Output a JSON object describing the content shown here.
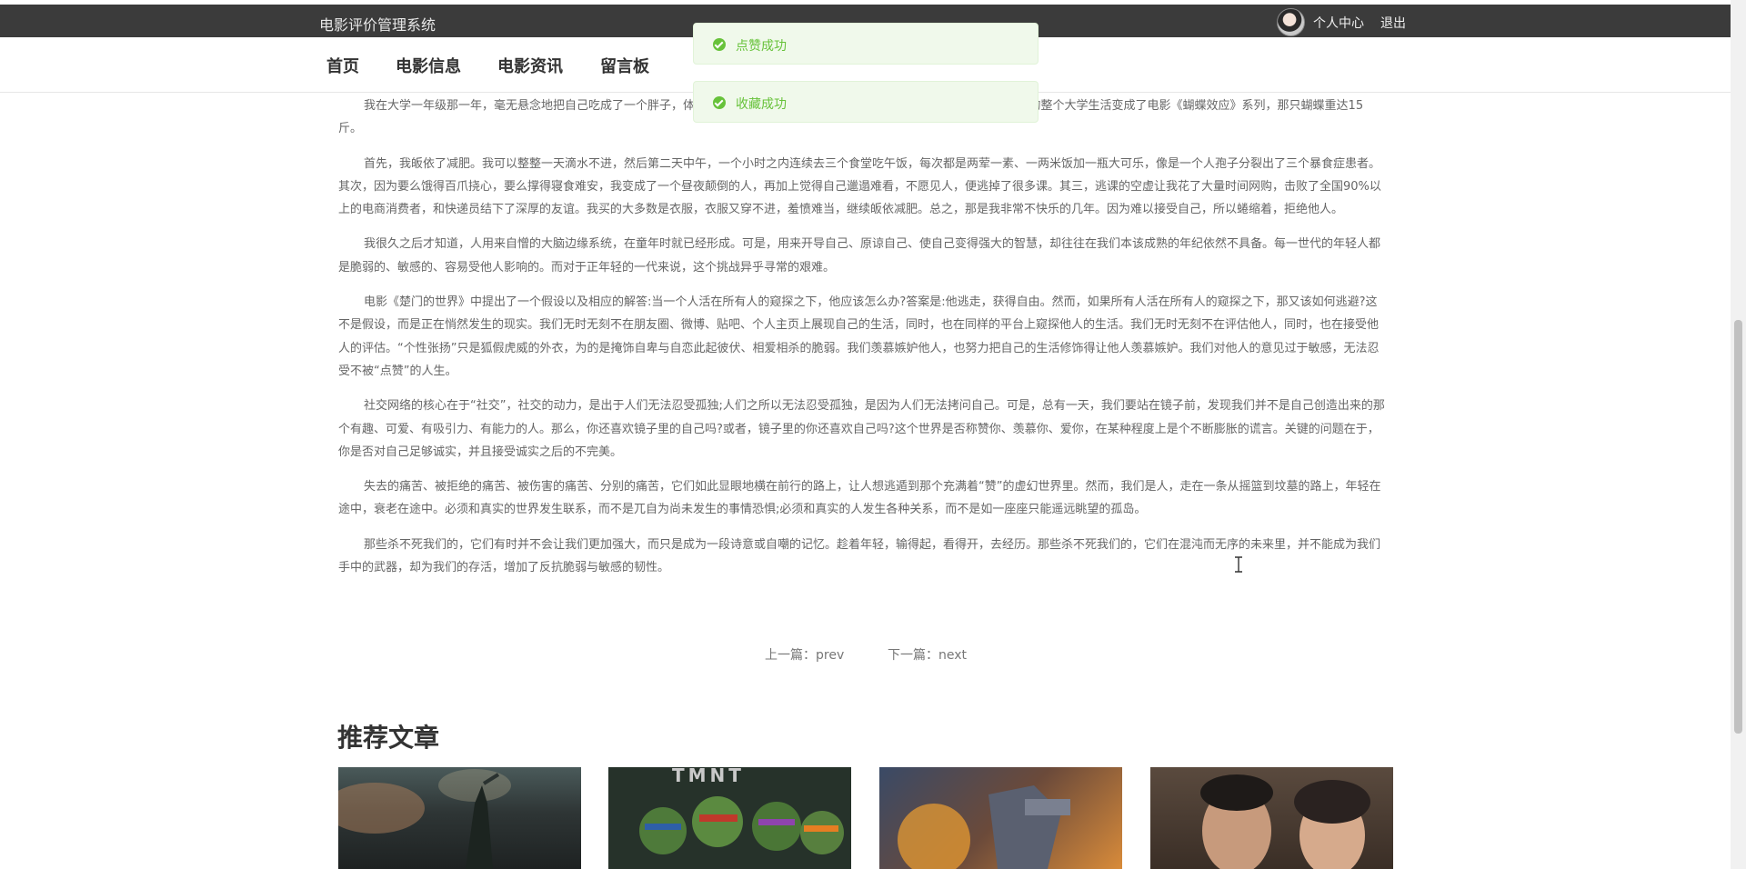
{
  "header": {
    "system_title": "电影评价管理系统",
    "user_center": "个人中心",
    "logout": "退出"
  },
  "nav": {
    "items": [
      "首页",
      "电影信息",
      "电影资讯",
      "留言板"
    ]
  },
  "toasts": [
    "点赞成功",
    "收藏成功"
  ],
  "article": {
    "paragraphs": [
      "我在大学一年级那一年，毫无悬念地把自己吃成了一个胖子，体重达到了人生巅峰。尴尬体型，比标准体型重了15斤。于是，我的整个大学生活变成了电影《蝴蝶效应》系列，那只蝴蝶重达15斤。",
      "首先，我皈依了减肥。我可以整整一天滴水不进，然后第二天中午，一个小时之内连续去三个食堂吃午饭，每次都是两荤一素、一两米饭加一瓶大可乐，像是一个人孢子分裂出了三个暴食症患者。其次，因为要么饿得百爪挠心，要么撑得寝食难安，我变成了一个昼夜颠倒的人，再加上觉得自己邋遢难看，不愿见人，便逃掉了很多课。其三，逃课的空虚让我花了大量时间网购，击败了全国90%以上的电商消费者，和快递员结下了深厚的友谊。我买的大多数是衣服，衣服又穿不进，羞愤难当，继续皈依减肥。总之，那是我非常不快乐的几年。因为难以接受自己，所以蜷缩着，拒绝他人。",
      "我很久之后才知道，人用来自憎的大脑边缘系统，在童年时就已经形成。可是，用来开导自己、原谅自己、使自己变得强大的智慧，却往往在我们本该成熟的年纪依然不具备。每一世代的年轻人都是脆弱的、敏感的、容易受他人影响的。而对于正年轻的一代来说，这个挑战异乎寻常的艰难。",
      "电影《楚门的世界》中提出了一个假设以及相应的解答:当一个人活在所有人的窥探之下，他应该怎么办?答案是:他逃走，获得自由。然而，如果所有人活在所有人的窥探之下，那又该如何逃避?这不是假设，而是正在悄然发生的现实。我们无时无刻不在朋友圈、微博、贴吧、个人主页上展现自己的生活，同时，也在同样的平台上窥探他人的生活。我们无时无刻不在评估他人，同时，也在接受他人的评估。“个性张扬”只是狐假虎威的外衣，为的是掩饰自卑与自恋此起彼伏、相爱相杀的脆弱。我们羡慕嫉妒他人，也努力把自己的生活修饰得让他人羡慕嫉妒。我们对他人的意见过于敏感，无法忍受不被“点赞”的人生。",
      "社交网络的核心在于“社交”，社交的动力，是出于人们无法忍受孤独;人们之所以无法忍受孤独，是因为人们无法拷问自己。可是，总有一天，我们要站在镜子前，发现我们并不是自己创造出来的那个有趣、可爱、有吸引力、有能力的人。那么，你还喜欢镜子里的自己吗?或者，镜子里的你还喜欢自己吗?这个世界是否称赞你、羡慕你、爱你，在某种程度上是个不断膨胀的谎言。关键的问题在于，你是否对自己足够诚实，并且接受诚实之后的不完美。",
      "失去的痛苦、被拒绝的痛苦、被伤害的痛苦、分别的痛苦，它们如此显眼地横在前行的路上，让人想逃遁到那个充满着“赞”的虚幻世界里。然而，我们是人，走在一条从摇篮到坟墓的路上，年轻在途中，衰老在途中。必须和真实的世界发生联系，而不是兀自为尚未发生的事情恐惧;必须和真实的人发生各种关系，而不是如一座座只能遥远眺望的孤岛。",
      "那些杀不死我们的，它们有时并不会让我们更加强大，而只是成为一段诗意或自嘲的记忆。趁着年轻，输得起，看得开，去经历。那些杀不死我们的，它们在混沌而无序的未来里，并不能成为我们手中的武器，却为我们的存活，增加了反抗脆弱与敏感的韧性。"
    ]
  },
  "pager": {
    "prev": "上一篇：prev",
    "next": "下一篇：next"
  },
  "recommend": {
    "title": "推荐文章",
    "cards": [
      "card-1",
      "card-2",
      "card-3",
      "card-4"
    ]
  },
  "colors": {
    "topbar": "#3b3b3b",
    "success": "#67c23a",
    "toast_bg": "#f0f9eb",
    "text": "#666666"
  }
}
